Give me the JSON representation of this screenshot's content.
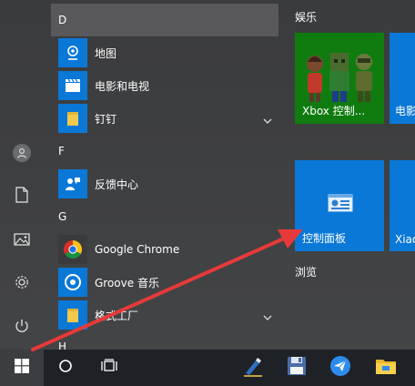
{
  "rail": {
    "items": [
      {
        "icon": "user-icon"
      },
      {
        "icon": "document-icon"
      },
      {
        "icon": "pictures-icon"
      },
      {
        "icon": "settings-gear-icon"
      },
      {
        "icon": "power-icon"
      }
    ]
  },
  "app_list": {
    "letters": {
      "d": "D",
      "f": "F",
      "g": "G",
      "h": "H"
    },
    "apps": {
      "maps": {
        "label": "地图",
        "icon": "maps-icon"
      },
      "movies": {
        "label": "电影和电视",
        "icon": "movies-tv-icon"
      },
      "dingding": {
        "label": "钉钉",
        "icon": "folder-icon"
      },
      "feedback": {
        "label": "反馈中心",
        "icon": "feedback-icon"
      },
      "chrome": {
        "label": "Google Chrome",
        "icon": "chrome-icon"
      },
      "groove": {
        "label": "Groove 音乐",
        "icon": "groove-icon"
      },
      "format_factory": {
        "label": "格式工厂",
        "icon": "folder-icon"
      }
    }
  },
  "tiles": {
    "groups": {
      "entertainment": "娱乐",
      "browse": "浏览"
    },
    "xbox": {
      "label": "Xbox 控制..."
    },
    "movies_partial": {
      "label": "电影"
    },
    "control_panel": {
      "label": "控制面板",
      "icon": "control-panel-icon"
    },
    "xiaobing_partial": {
      "label": "Xiao"
    }
  },
  "taskbar": {
    "items": [
      {
        "icon": "windows-logo-icon"
      },
      {
        "icon": "cortana-search-icon"
      },
      {
        "icon": "task-view-icon"
      },
      {
        "icon": "pen-app-icon"
      },
      {
        "icon": "floppy-save-icon"
      },
      {
        "icon": "paper-plane-icon"
      },
      {
        "icon": "file-explorer-icon"
      }
    ]
  },
  "colors": {
    "accent_blue": "#0a78d7",
    "xbox_green": "#107c10",
    "arrow_red": "#e63a3a",
    "taskbar": "#1e2226"
  }
}
